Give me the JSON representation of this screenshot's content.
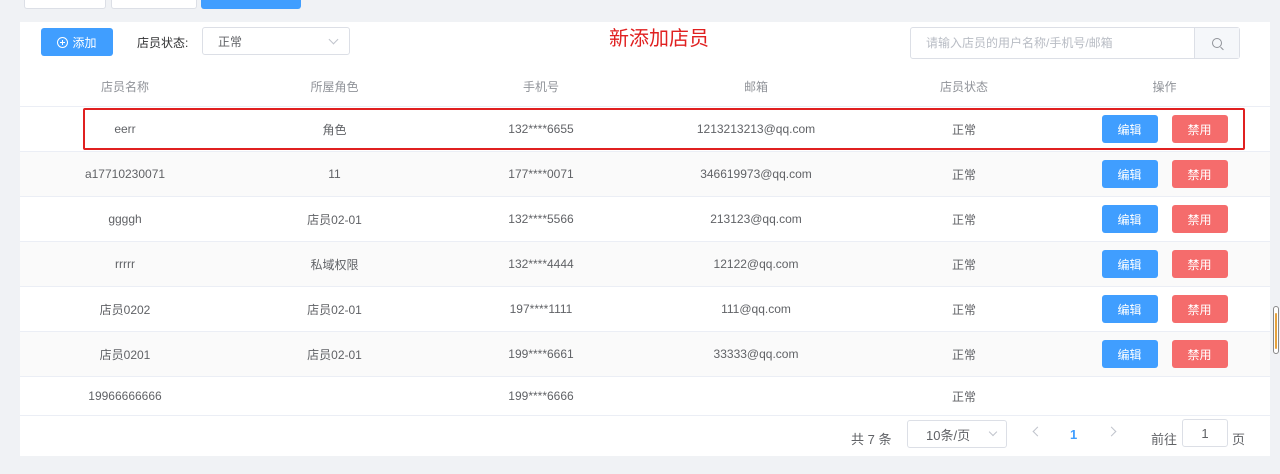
{
  "toolbar": {
    "add_label": "添加",
    "status_label": "店员状态:",
    "status_selected": "正常",
    "annotation": "新添加店员",
    "search_placeholder": "请输入店员的用户名称/手机号/邮箱"
  },
  "table": {
    "headers": [
      "店员名称",
      "所屋角色",
      "手机号",
      "邮箱",
      "店员状态",
      "操作"
    ],
    "edit_label": "编辑",
    "disable_label": "禁用",
    "rows": [
      {
        "name": "eerr",
        "role": "角色",
        "phone": "132****6655",
        "email": "1213213213@qq.com",
        "status": "正常"
      },
      {
        "name": "a17710230071",
        "role": "11",
        "phone": "177****0071",
        "email": "346619973@qq.com",
        "status": "正常"
      },
      {
        "name": "ggggh",
        "role": "店员02-01",
        "phone": "132****5566",
        "email": "213123@qq.com",
        "status": "正常"
      },
      {
        "name": "rrrrr",
        "role": "私域权限",
        "phone": "132****4444",
        "email": "12122@qq.com",
        "status": "正常"
      },
      {
        "name": "店员0202",
        "role": "店员02-01",
        "phone": "197****1111",
        "email": "111@qq.com",
        "status": "正常"
      },
      {
        "name": "店员0201",
        "role": "店员02-01",
        "phone": "199****6661",
        "email": "33333@qq.com",
        "status": "正常"
      },
      {
        "name": "19966666666",
        "role": "",
        "phone": "199****6666",
        "email": "",
        "status": "正常"
      }
    ]
  },
  "pagination": {
    "total": "共 7 条",
    "page_size": "10条/页",
    "current_page": "1",
    "goto_label": "前往",
    "goto_value": "1",
    "goto_unit": "页"
  },
  "colors": {
    "primary": "#409eff",
    "danger": "#f56c6c",
    "annotation": "#e02020"
  }
}
